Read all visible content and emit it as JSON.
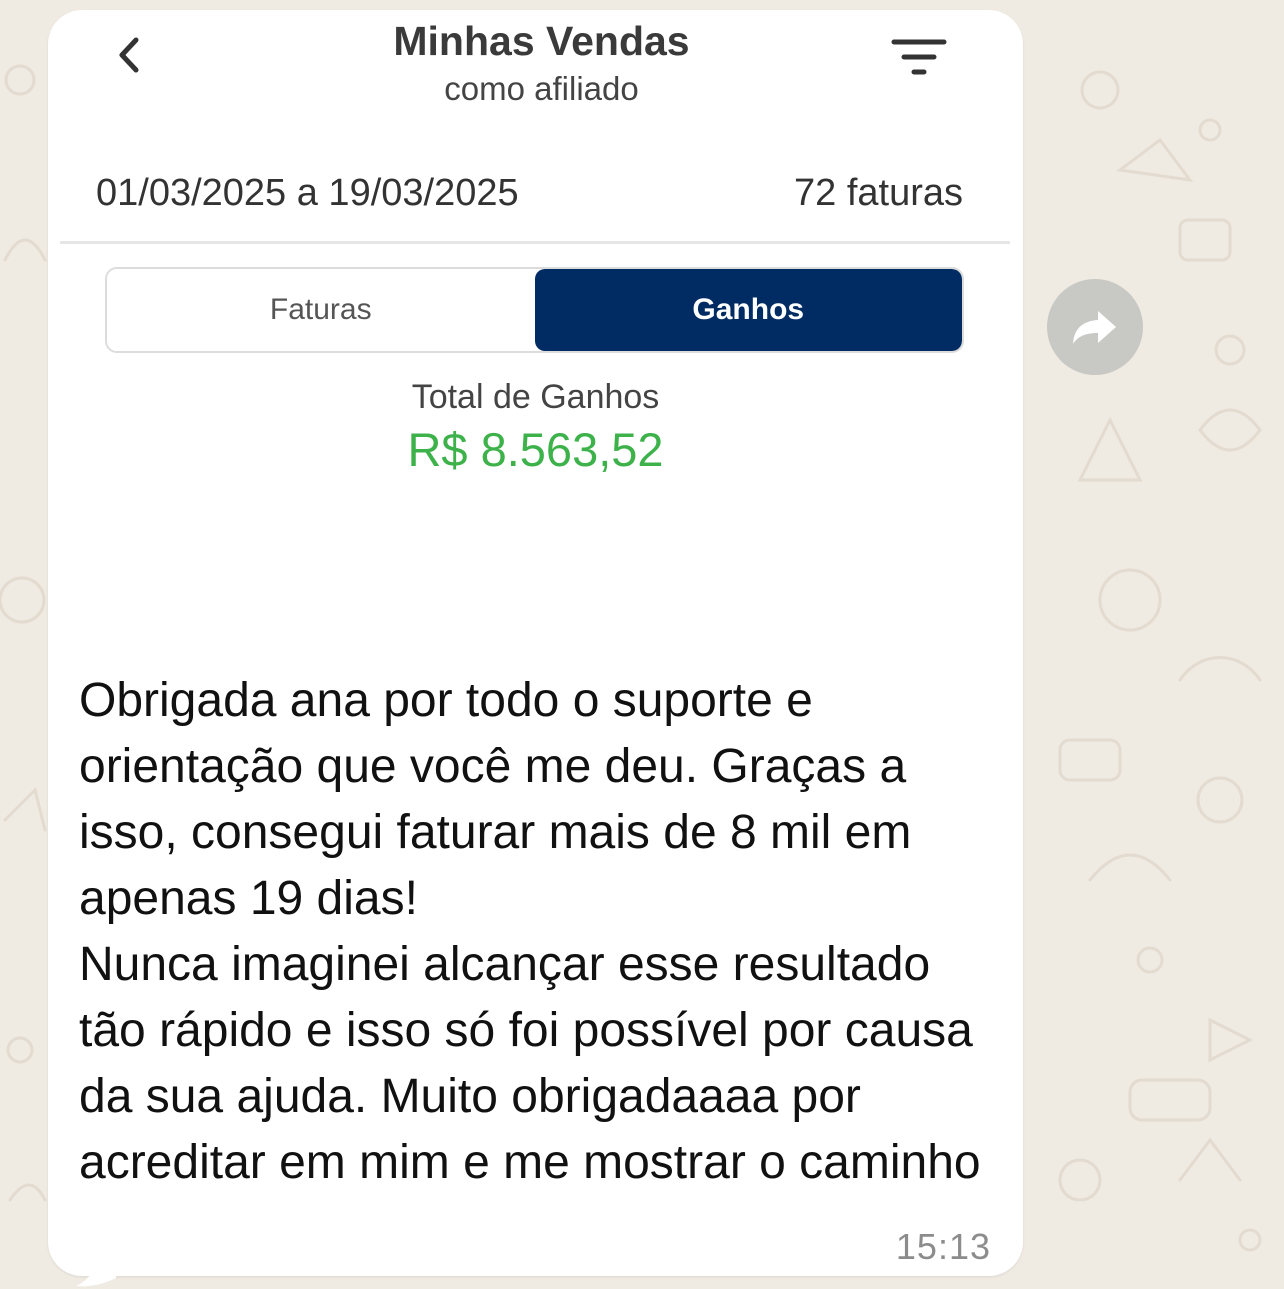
{
  "screenshot": {
    "header": {
      "title": "Minhas Vendas",
      "subtitle": "como afiliado",
      "back_icon": "chevron-left-icon",
      "filter_icon": "filter-icon"
    },
    "period": "01/03/2025 a 19/03/2025",
    "invoice_count": "72 faturas",
    "tabs": [
      {
        "label": "Faturas",
        "selected": false
      },
      {
        "label": "Ganhos",
        "selected": true
      }
    ],
    "total_label": "Total de Ganhos",
    "total_value": "R$ 8.563,52",
    "colors": {
      "tab_active": "#002b63",
      "total_value": "#3db24a"
    }
  },
  "message": {
    "text": "Obrigada ana por todo o suporte e orientação que você me deu. Graças a isso, consegui faturar mais de 8 mil em apenas 19 dias!\nNunca imaginei alcançar esse resultado tão rápido e isso só foi possível por causa da sua ajuda. Muito obrigadaaaa por acreditar em mim e me mostrar o caminho",
    "time": "15:13"
  },
  "forward_icon": "forward-arrow-icon",
  "colors": {
    "chat_background": "#efeae2",
    "bubble": "#ffffff"
  }
}
